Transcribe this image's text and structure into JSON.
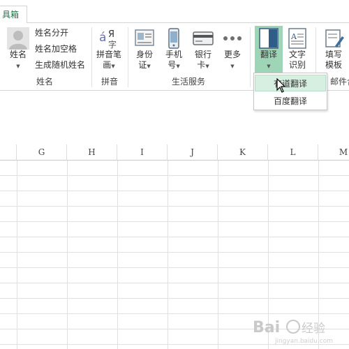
{
  "tab": {
    "label": "具箱"
  },
  "ribbon": {
    "name_group": {
      "main_button": "姓名",
      "small_buttons": [
        "姓名分开",
        "姓名加空格",
        "生成随机姓名"
      ],
      "label": "姓名"
    },
    "pinyin_group": {
      "button_line1": "拼音笔",
      "button_line2": "画",
      "label": "拼音"
    },
    "life_group": {
      "buttons": [
        {
          "line1": "身份",
          "line2": "证"
        },
        {
          "line1": "手机",
          "line2": "号"
        },
        {
          "line1": "银行",
          "line2": "卡"
        },
        {
          "line1": "更多",
          "line2": ""
        }
      ],
      "label": "生活服务"
    },
    "translate_button": "翻译",
    "ocr_button": {
      "line1": "文字",
      "line2": "识别"
    },
    "fill_button": {
      "line1": "填写",
      "line2": "模板"
    },
    "mail_group_label": "邮件合"
  },
  "translate_menu": {
    "items": [
      {
        "label": "有道翻译",
        "highlighted": true
      },
      {
        "label": "百度翻译",
        "highlighted": false
      }
    ]
  },
  "sheet": {
    "columns": [
      "G",
      "H",
      "I",
      "J",
      "K",
      "L",
      "M"
    ]
  },
  "watermark": {
    "text": "Bai 经验",
    "sub": "jingyan.baidu.com"
  },
  "colors": {
    "accent": "#217346",
    "active_button": "#9fd5b7",
    "menu_highlight": "#d7efe0"
  }
}
